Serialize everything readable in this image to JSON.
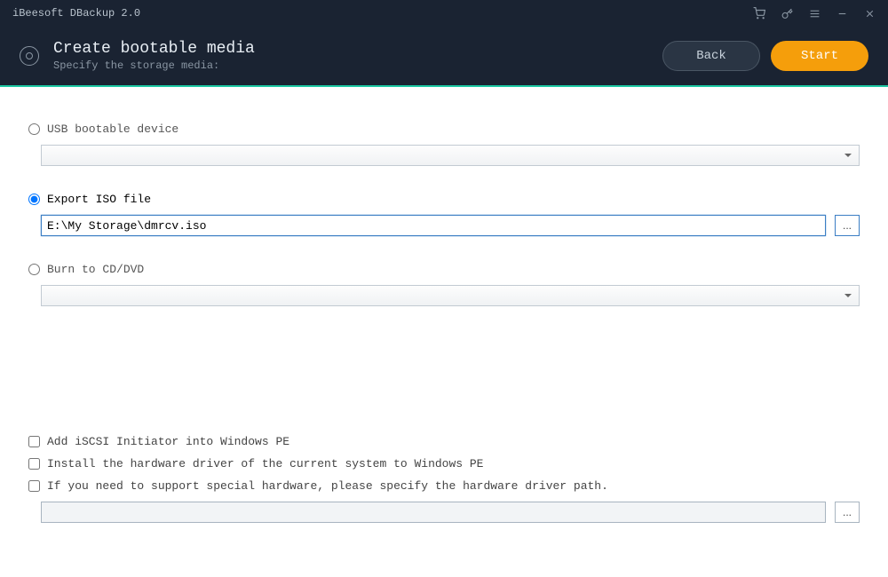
{
  "titlebar": {
    "title": "iBeesoft DBackup 2.0"
  },
  "header": {
    "title": "Create bootable media",
    "subtitle": "Specify the storage media:",
    "back_label": "Back",
    "start_label": "Start"
  },
  "options": {
    "usb": {
      "label": "USB bootable device",
      "checked": false
    },
    "iso": {
      "label": "Export ISO file",
      "checked": true,
      "path": "E:\\My Storage\\dmrcv.iso",
      "browse": "..."
    },
    "cd": {
      "label": "Burn to CD/DVD",
      "checked": false
    }
  },
  "advanced": {
    "iscsi": {
      "label": "Add iSCSI Initiator into Windows PE",
      "checked": false
    },
    "driver_install": {
      "label": "Install the hardware driver of the current system to Windows PE",
      "checked": false
    },
    "driver_path": {
      "label": "If you need to support special hardware, please specify the hardware driver path.",
      "checked": false,
      "path": "",
      "browse": "..."
    }
  }
}
